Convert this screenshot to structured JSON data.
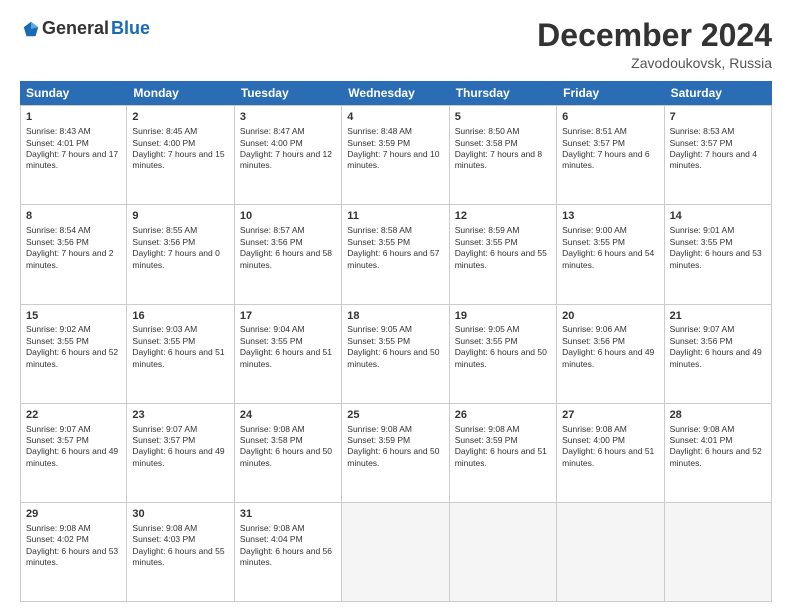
{
  "logo": {
    "general": "General",
    "blue": "Blue"
  },
  "title": "December 2024",
  "location": "Zavodoukovsk, Russia",
  "header_days": [
    "Sunday",
    "Monday",
    "Tuesday",
    "Wednesday",
    "Thursday",
    "Friday",
    "Saturday"
  ],
  "weeks": [
    [
      {
        "day": "1",
        "sunrise": "Sunrise: 8:43 AM",
        "sunset": "Sunset: 4:01 PM",
        "daylight": "Daylight: 7 hours and 17 minutes."
      },
      {
        "day": "2",
        "sunrise": "Sunrise: 8:45 AM",
        "sunset": "Sunset: 4:00 PM",
        "daylight": "Daylight: 7 hours and 15 minutes."
      },
      {
        "day": "3",
        "sunrise": "Sunrise: 8:47 AM",
        "sunset": "Sunset: 4:00 PM",
        "daylight": "Daylight: 7 hours and 12 minutes."
      },
      {
        "day": "4",
        "sunrise": "Sunrise: 8:48 AM",
        "sunset": "Sunset: 3:59 PM",
        "daylight": "Daylight: 7 hours and 10 minutes."
      },
      {
        "day": "5",
        "sunrise": "Sunrise: 8:50 AM",
        "sunset": "Sunset: 3:58 PM",
        "daylight": "Daylight: 7 hours and 8 minutes."
      },
      {
        "day": "6",
        "sunrise": "Sunrise: 8:51 AM",
        "sunset": "Sunset: 3:57 PM",
        "daylight": "Daylight: 7 hours and 6 minutes."
      },
      {
        "day": "7",
        "sunrise": "Sunrise: 8:53 AM",
        "sunset": "Sunset: 3:57 PM",
        "daylight": "Daylight: 7 hours and 4 minutes."
      }
    ],
    [
      {
        "day": "8",
        "sunrise": "Sunrise: 8:54 AM",
        "sunset": "Sunset: 3:56 PM",
        "daylight": "Daylight: 7 hours and 2 minutes."
      },
      {
        "day": "9",
        "sunrise": "Sunrise: 8:55 AM",
        "sunset": "Sunset: 3:56 PM",
        "daylight": "Daylight: 7 hours and 0 minutes."
      },
      {
        "day": "10",
        "sunrise": "Sunrise: 8:57 AM",
        "sunset": "Sunset: 3:56 PM",
        "daylight": "Daylight: 6 hours and 58 minutes."
      },
      {
        "day": "11",
        "sunrise": "Sunrise: 8:58 AM",
        "sunset": "Sunset: 3:55 PM",
        "daylight": "Daylight: 6 hours and 57 minutes."
      },
      {
        "day": "12",
        "sunrise": "Sunrise: 8:59 AM",
        "sunset": "Sunset: 3:55 PM",
        "daylight": "Daylight: 6 hours and 55 minutes."
      },
      {
        "day": "13",
        "sunrise": "Sunrise: 9:00 AM",
        "sunset": "Sunset: 3:55 PM",
        "daylight": "Daylight: 6 hours and 54 minutes."
      },
      {
        "day": "14",
        "sunrise": "Sunrise: 9:01 AM",
        "sunset": "Sunset: 3:55 PM",
        "daylight": "Daylight: 6 hours and 53 minutes."
      }
    ],
    [
      {
        "day": "15",
        "sunrise": "Sunrise: 9:02 AM",
        "sunset": "Sunset: 3:55 PM",
        "daylight": "Daylight: 6 hours and 52 minutes."
      },
      {
        "day": "16",
        "sunrise": "Sunrise: 9:03 AM",
        "sunset": "Sunset: 3:55 PM",
        "daylight": "Daylight: 6 hours and 51 minutes."
      },
      {
        "day": "17",
        "sunrise": "Sunrise: 9:04 AM",
        "sunset": "Sunset: 3:55 PM",
        "daylight": "Daylight: 6 hours and 51 minutes."
      },
      {
        "day": "18",
        "sunrise": "Sunrise: 9:05 AM",
        "sunset": "Sunset: 3:55 PM",
        "daylight": "Daylight: 6 hours and 50 minutes."
      },
      {
        "day": "19",
        "sunrise": "Sunrise: 9:05 AM",
        "sunset": "Sunset: 3:55 PM",
        "daylight": "Daylight: 6 hours and 50 minutes."
      },
      {
        "day": "20",
        "sunrise": "Sunrise: 9:06 AM",
        "sunset": "Sunset: 3:56 PM",
        "daylight": "Daylight: 6 hours and 49 minutes."
      },
      {
        "day": "21",
        "sunrise": "Sunrise: 9:07 AM",
        "sunset": "Sunset: 3:56 PM",
        "daylight": "Daylight: 6 hours and 49 minutes."
      }
    ],
    [
      {
        "day": "22",
        "sunrise": "Sunrise: 9:07 AM",
        "sunset": "Sunset: 3:57 PM",
        "daylight": "Daylight: 6 hours and 49 minutes."
      },
      {
        "day": "23",
        "sunrise": "Sunrise: 9:07 AM",
        "sunset": "Sunset: 3:57 PM",
        "daylight": "Daylight: 6 hours and 49 minutes."
      },
      {
        "day": "24",
        "sunrise": "Sunrise: 9:08 AM",
        "sunset": "Sunset: 3:58 PM",
        "daylight": "Daylight: 6 hours and 50 minutes."
      },
      {
        "day": "25",
        "sunrise": "Sunrise: 9:08 AM",
        "sunset": "Sunset: 3:59 PM",
        "daylight": "Daylight: 6 hours and 50 minutes."
      },
      {
        "day": "26",
        "sunrise": "Sunrise: 9:08 AM",
        "sunset": "Sunset: 3:59 PM",
        "daylight": "Daylight: 6 hours and 51 minutes."
      },
      {
        "day": "27",
        "sunrise": "Sunrise: 9:08 AM",
        "sunset": "Sunset: 4:00 PM",
        "daylight": "Daylight: 6 hours and 51 minutes."
      },
      {
        "day": "28",
        "sunrise": "Sunrise: 9:08 AM",
        "sunset": "Sunset: 4:01 PM",
        "daylight": "Daylight: 6 hours and 52 minutes."
      }
    ],
    [
      {
        "day": "29",
        "sunrise": "Sunrise: 9:08 AM",
        "sunset": "Sunset: 4:02 PM",
        "daylight": "Daylight: 6 hours and 53 minutes."
      },
      {
        "day": "30",
        "sunrise": "Sunrise: 9:08 AM",
        "sunset": "Sunset: 4:03 PM",
        "daylight": "Daylight: 6 hours and 55 minutes."
      },
      {
        "day": "31",
        "sunrise": "Sunrise: 9:08 AM",
        "sunset": "Sunset: 4:04 PM",
        "daylight": "Daylight: 6 hours and 56 minutes."
      },
      null,
      null,
      null,
      null
    ]
  ]
}
